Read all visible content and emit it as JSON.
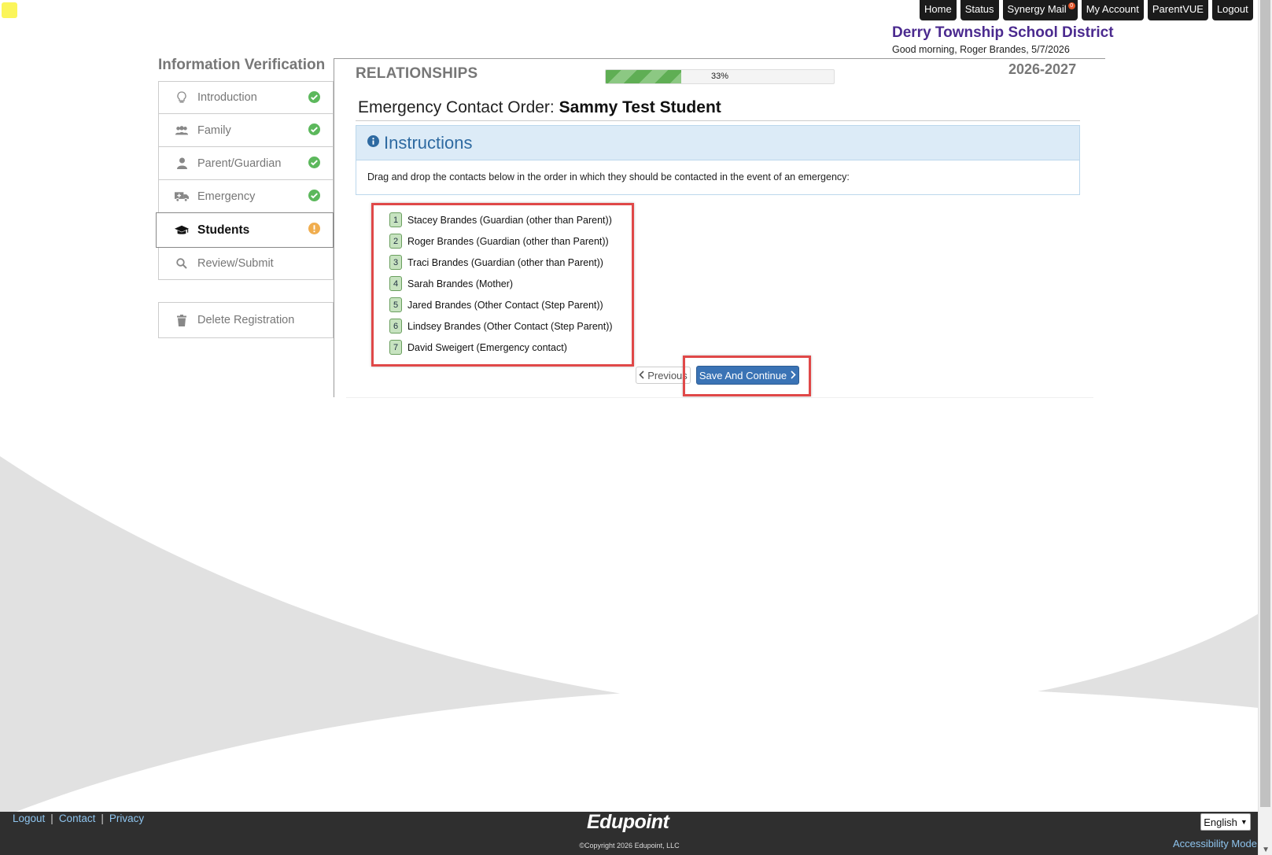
{
  "topnav": {
    "items": [
      {
        "label": "Home"
      },
      {
        "label": "Status"
      },
      {
        "label": "Synergy Mail",
        "badge": "0"
      },
      {
        "label": "My Account"
      },
      {
        "label": "ParentVUE"
      },
      {
        "label": "Logout"
      }
    ]
  },
  "header": {
    "district": "Derry Township School District",
    "greeting": "Good morning, Roger Brandes, 5/7/2026",
    "district_color": "#4b2a8f"
  },
  "sidebar": {
    "title": "Information Verification",
    "steps": [
      {
        "label": "Introduction",
        "icon": "lightbulb-icon",
        "status": "complete"
      },
      {
        "label": "Family",
        "icon": "people-icon",
        "status": "complete"
      },
      {
        "label": "Parent/Guardian",
        "icon": "person-icon",
        "status": "complete"
      },
      {
        "label": "Emergency",
        "icon": "ambulance-icon",
        "status": "complete"
      },
      {
        "label": "Students",
        "icon": "graduation-cap-icon",
        "status": "warning"
      },
      {
        "label": "Review/Submit",
        "icon": "search-icon",
        "status": "none"
      }
    ],
    "delete_label": "Delete Registration"
  },
  "main": {
    "section_title": "RELATIONSHIPS",
    "progress": {
      "percent": 33,
      "label": "33%"
    },
    "year": "2026-2027",
    "contact_order_prefix": "Emergency Contact Order: ",
    "student_name": "Sammy Test Student",
    "instructions": {
      "title": "Instructions",
      "text": "Drag and drop the contacts below in the order in which they should be contacted in the event of an emergency:"
    },
    "contacts": [
      {
        "num": "1",
        "label": "Stacey Brandes (Guardian (other than Parent))"
      },
      {
        "num": "2",
        "label": "Roger Brandes (Guardian (other than Parent))"
      },
      {
        "num": "3",
        "label": "Traci Brandes (Guardian (other than Parent))"
      },
      {
        "num": "4",
        "label": "Sarah Brandes (Mother)"
      },
      {
        "num": "5",
        "label": "Jared Brandes (Other Contact (Step Parent))"
      },
      {
        "num": "6",
        "label": "Lindsey Brandes (Other Contact (Step Parent))"
      },
      {
        "num": "7",
        "label": "David Sweigert (Emergency contact)"
      }
    ],
    "previous_label": "Previous",
    "save_label": "Save And Continue"
  },
  "footer": {
    "links": [
      "Logout",
      "Contact",
      "Privacy"
    ],
    "logo": "Edupoint",
    "copyright": "©Copyright 2026 Edupoint, LLC",
    "language": "English",
    "accessibility": "Accessibility Mode"
  },
  "colors": {
    "accent_red": "#e04848",
    "primary_button": "#3a73b5",
    "progress_green": "#5fae54",
    "complete_green": "#5cb85c",
    "warning_orange": "#f0ad4e"
  }
}
